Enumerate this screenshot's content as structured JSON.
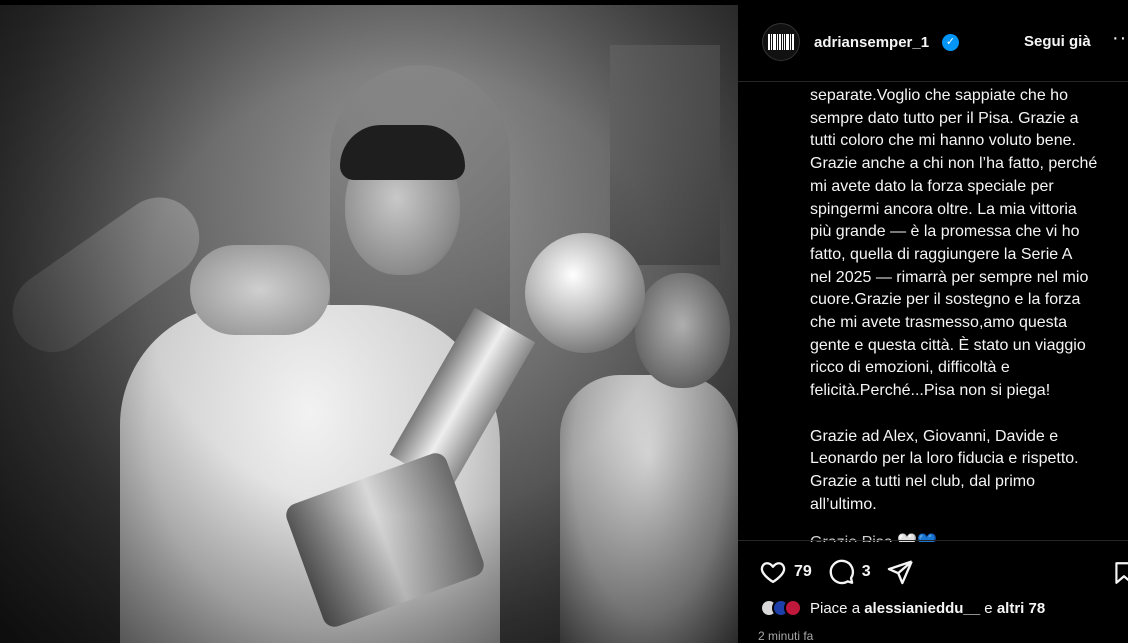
{
  "post": {
    "account": {
      "username": "adriansemper_1",
      "verified_mark": "✓",
      "follow_label": "Segui già",
      "more_label": "··"
    },
    "caption": "separate.Voglio che sappiate che ho\nsempre dato tutto per il Pisa. Grazie a\ntutti coloro che mi hanno voluto bene.\nGrazie anche a chi non l’ha fatto, perché\nmi avete dato la forza speciale per\nspingermi ancora oltre. La mia vittoria\npiù grande — è la promessa che vi ho\nfatto, quella di raggiungere la Serie A\nnel 2025 — rimarrà per sempre nel mio\ncuore.Grazie per il sostegno e la forza\nche mi avete trasmesso,amo questa\ngente e questa città. È stato un viaggio\nricco di emozioni, difficoltà e\nfelicità.Perché...Pisa non si piega!\n\nGrazie ad Alex, Giovanni, Davide e\nLeonardo per la loro fiducia e rispetto.\nGrazie a tutti nel club, dal primo\nall’ultimo.",
    "caption_cutoff": "Grazie Pisa 🤍💙",
    "actions": {
      "like_count": "79",
      "comment_count": "3"
    },
    "likes": {
      "prefix": "Piace a",
      "first_user": "alessianieddu__",
      "connector": "e",
      "others": "altri 78"
    },
    "timestamp": "2 minuti fa"
  },
  "icons": [
    "heart-icon",
    "comment-icon",
    "share-icon",
    "bookmark-icon",
    "verified-icon",
    "more-icon"
  ],
  "colors": {
    "background": "#000000",
    "text": "#f5f5f5",
    "muted": "#a8a8a8",
    "verified": "#0095f6",
    "divider": "#262626"
  }
}
